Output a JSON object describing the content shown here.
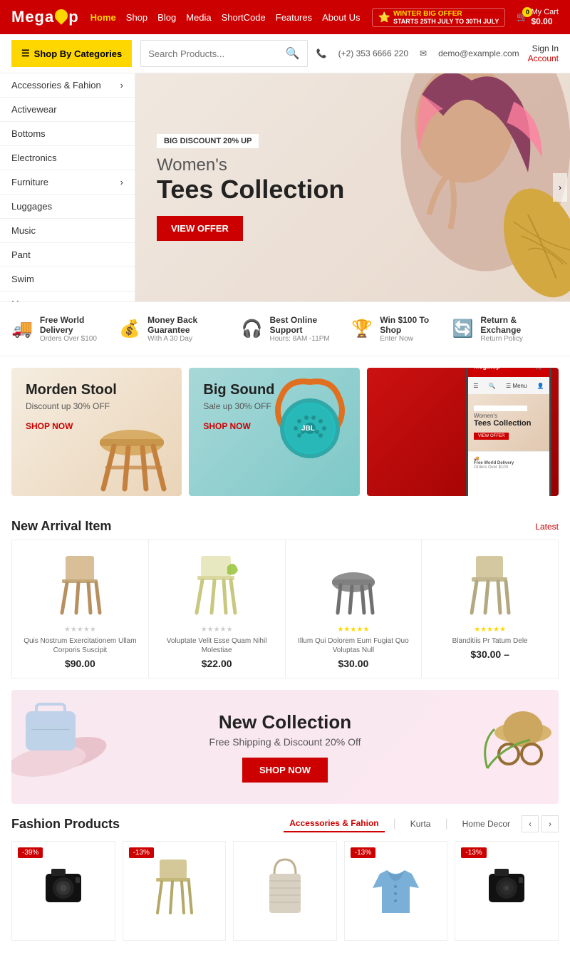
{
  "brand": {
    "name_part1": "Mega",
    "name_part2": "p",
    "name_part3": "p"
  },
  "topbar": {
    "logo": "Megatop",
    "nav_items": [
      "Home",
      "Shop",
      "Blog",
      "Media",
      "ShortCode",
      "Features",
      "About Us"
    ],
    "active_nav": "Home",
    "winter_offer_line1": "WINTER BIG OFFER",
    "winter_offer_line2": "STARTS 25TH JULY TO 30TH JULY",
    "cart_label": "My Cart",
    "cart_amount": "$0.00",
    "cart_count": "0"
  },
  "searchbar": {
    "category_btn": "Shop By Categories",
    "search_placeholder": "Search Products...",
    "phone": "(+2) 353 6666 220",
    "email": "demo@example.com",
    "signin_line1": "Sign In",
    "signin_line2": "Account"
  },
  "sidebar_menu": {
    "items": [
      {
        "label": "Accessories & Fahion",
        "has_arrow": true
      },
      {
        "label": "Activewear",
        "has_arrow": false
      },
      {
        "label": "Bottoms",
        "has_arrow": false
      },
      {
        "label": "Electronics",
        "has_arrow": false
      },
      {
        "label": "Furniture",
        "has_arrow": true
      },
      {
        "label": "Luggages",
        "has_arrow": false
      },
      {
        "label": "Music",
        "has_arrow": false
      },
      {
        "label": "Pant",
        "has_arrow": false
      },
      {
        "label": "Swim",
        "has_arrow": false
      },
      {
        "label": "More",
        "has_arrow": true
      }
    ]
  },
  "hero": {
    "badge": "BIG DISCOUNT 20% UP",
    "subtitle": "Women's",
    "title": "Tees Collection",
    "cta": "VIEW OFFER"
  },
  "features": [
    {
      "icon": "🚚",
      "title": "Free World Delivery",
      "sub": "Orders Over $100"
    },
    {
      "icon": "💰",
      "title": "Money Back Guarantee",
      "sub": "With A 30 Day"
    },
    {
      "icon": "🎧",
      "title": "Best Online Support",
      "sub": "Hours: 8AM -11PM"
    },
    {
      "icon": "🏆",
      "title": "Win $100 To Shop",
      "sub": "Enter Now"
    },
    {
      "icon": "🔄",
      "title": "Return & Exchange",
      "sub": "Return Policy"
    }
  ],
  "promo_cards": [
    {
      "id": "stool",
      "label": "",
      "title": "Morden Stool",
      "sub": "Discount up 30% OFF",
      "cta": "SHOP NOW"
    },
    {
      "id": "speaker",
      "label": "",
      "title": "Big Sound",
      "sub": "Sale up 30% OFF",
      "cta": "SHOP NOW"
    }
  ],
  "phone_mockup": {
    "logo": "Megatop",
    "menu_label": "Menu",
    "banner_badge": "BIG DISCOUNT 20% UP",
    "banner_subtitle": "Women's",
    "banner_title": "Tees Collection",
    "banner_cta": "VIEW OFFER",
    "delivery_title": "Free World Delivery",
    "delivery_sub": "Orders Over $100"
  },
  "new_arrival": {
    "section_title": "New Arrival Item",
    "section_link": "Latest",
    "products": [
      {
        "stars": 0,
        "desc": "Quis Nostrum Exercitationem Ullam Corporis Suscipit",
        "price": "$90.00"
      },
      {
        "stars": 0,
        "desc": "Voluptate Velit Esse Quam Nihil Molestiae",
        "price": "$22.00"
      },
      {
        "stars": 5,
        "desc": "Illum Qui Dolorem Eum Fugiat Quo Voluptas Null",
        "price": "$30.00"
      },
      {
        "stars": 5,
        "desc": "Blanditiis Pr Tatum Dele",
        "price": "$30.00"
      }
    ]
  },
  "new_collection": {
    "title": "New Collection",
    "subtitle": "Free Shipping & Discount 20% Off",
    "cta": "SHOP NOW"
  },
  "fashion_products": {
    "section_title": "Fashion Products",
    "tabs": [
      "Accessories & Fahion",
      "Kurta",
      "Home Decor"
    ],
    "active_tab": "Accessories & Fahion",
    "products": [
      {
        "discount": "-39%",
        "name": "Camera"
      },
      {
        "discount": "-13%",
        "name": "Chair"
      },
      {
        "discount": "",
        "name": "Basket"
      },
      {
        "discount": "-13%",
        "name": "Shirt"
      },
      {
        "discount": "-13%",
        "name": "Camera 2"
      }
    ]
  }
}
